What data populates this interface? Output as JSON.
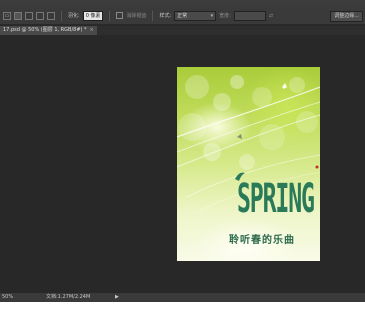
{
  "options_bar": {
    "tools": [
      "new-selection",
      "add-to-selection",
      "subtract-selection",
      "intersect-selection"
    ],
    "feather_label": "羽化:",
    "feather_value": "0 像素",
    "antialias_label": "消除锯齿",
    "style_label": "样式:",
    "style_value": "正常",
    "width_label": "宽度:",
    "refine_edge": "调整边缘..."
  },
  "document_tab": {
    "title": "17.psd @ 50% (图层 1, RGB/8#) *",
    "close": "×"
  },
  "artwork": {
    "headline": "SPRING",
    "subtitle": "聆听春的乐曲"
  },
  "status": {
    "zoom": "50%",
    "doc_size": "文档:1.27M/2.24M",
    "arrow": "▶"
  },
  "colors": {
    "workspace": "#282828",
    "panel": "#3a3a3a",
    "headline": "#2a7a5a"
  }
}
